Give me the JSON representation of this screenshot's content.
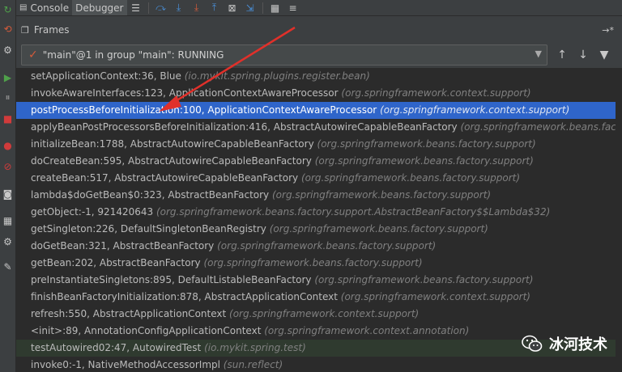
{
  "toolbar": {
    "tabs": [
      {
        "label": "Console",
        "icon": "console-icon"
      },
      {
        "label": "Debugger",
        "icon": "debugger-icon"
      }
    ],
    "buttons": [
      "menu-icon",
      "step-over-icon",
      "step-into-icon",
      "force-step-into-icon",
      "step-out-icon",
      "drop-frame-icon",
      "run-to-cursor-icon",
      "evaluate-icon"
    ]
  },
  "frames_panel": {
    "title": "Frames",
    "thread_selector": {
      "value": "\"main\"@1 in group \"main\": RUNNING",
      "check_color": "#d45b3b"
    },
    "frames": [
      {
        "method": "setApplicationContext:36, Blue",
        "pkg": "(io.mykit.spring.plugins.register.bean)",
        "state": "normal"
      },
      {
        "method": "invokeAwareInterfaces:123, ApplicationContextAwareProcessor",
        "pkg": "(org.springframework.context.support)",
        "state": "normal"
      },
      {
        "method": "postProcessBeforeInitialization:100, ApplicationContextAwareProcessor",
        "pkg": "(org.springframework.context.support)",
        "state": "selected"
      },
      {
        "method": "applyBeanPostProcessorsBeforeInitialization:416, AbstractAutowireCapableBeanFactory",
        "pkg": "(org.springframework.beans.factory.",
        "state": "normal"
      },
      {
        "method": "initializeBean:1788, AbstractAutowireCapableBeanFactory",
        "pkg": "(org.springframework.beans.factory.support)",
        "state": "normal"
      },
      {
        "method": "doCreateBean:595, AbstractAutowireCapableBeanFactory",
        "pkg": "(org.springframework.beans.factory.support)",
        "state": "normal"
      },
      {
        "method": "createBean:517, AbstractAutowireCapableBeanFactory",
        "pkg": "(org.springframework.beans.factory.support)",
        "state": "normal"
      },
      {
        "method": "lambda$doGetBean$0:323, AbstractBeanFactory",
        "pkg": "(org.springframework.beans.factory.support)",
        "state": "normal"
      },
      {
        "method": "getObject:-1, 921420643",
        "pkg": "(org.springframework.beans.factory.support.AbstractBeanFactory$$Lambda$32)",
        "state": "normal"
      },
      {
        "method": "getSingleton:226, DefaultSingletonBeanRegistry",
        "pkg": "(org.springframework.beans.factory.support)",
        "state": "normal"
      },
      {
        "method": "doGetBean:321, AbstractBeanFactory",
        "pkg": "(org.springframework.beans.factory.support)",
        "state": "normal"
      },
      {
        "method": "getBean:202, AbstractBeanFactory",
        "pkg": "(org.springframework.beans.factory.support)",
        "state": "normal"
      },
      {
        "method": "preInstantiateSingletons:895, DefaultListableBeanFactory",
        "pkg": "(org.springframework.beans.factory.support)",
        "state": "normal"
      },
      {
        "method": "finishBeanFactoryInitialization:878, AbstractApplicationContext",
        "pkg": "(org.springframework.context.support)",
        "state": "normal"
      },
      {
        "method": "refresh:550, AbstractApplicationContext",
        "pkg": "(org.springframework.context.support)",
        "state": "normal"
      },
      {
        "method": "<init>:89, AnnotationConfigApplicationContext",
        "pkg": "(org.springframework.context.annotation)",
        "state": "normal"
      },
      {
        "method": "testAutowired02:47, AutowiredTest",
        "pkg": "(io.mykit.spring.test)",
        "state": "lib"
      },
      {
        "method": "invoke0:-1, NativeMethodAccessorImpl",
        "pkg": "(sun.reflect)",
        "state": "normal"
      }
    ]
  },
  "watermark": {
    "text": "冰河技术"
  },
  "colors": {
    "selection": "#2f65ca",
    "arrow": "#e0302a",
    "panel_bg": "#2b2b2b",
    "chrome_bg": "#3c3f41"
  }
}
